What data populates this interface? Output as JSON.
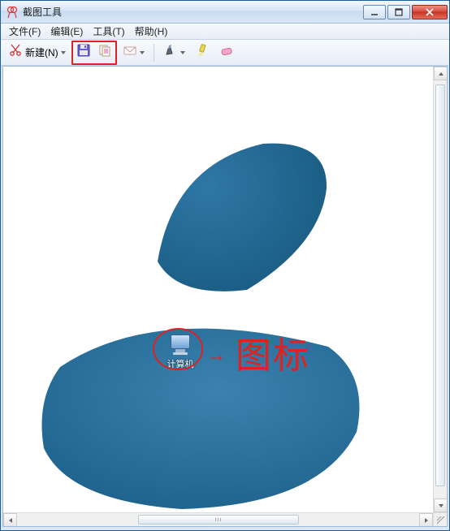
{
  "window": {
    "title": "截图工具"
  },
  "menus": {
    "file": "文件(F)",
    "edit": "编辑(E)",
    "tools": "工具(T)",
    "help": "帮助(H)"
  },
  "toolbar": {
    "new_label": "新建(N)"
  },
  "canvas": {
    "desktop_icon_label": "计算机",
    "annotation_text": "图标",
    "annotation_arrow": "→"
  }
}
